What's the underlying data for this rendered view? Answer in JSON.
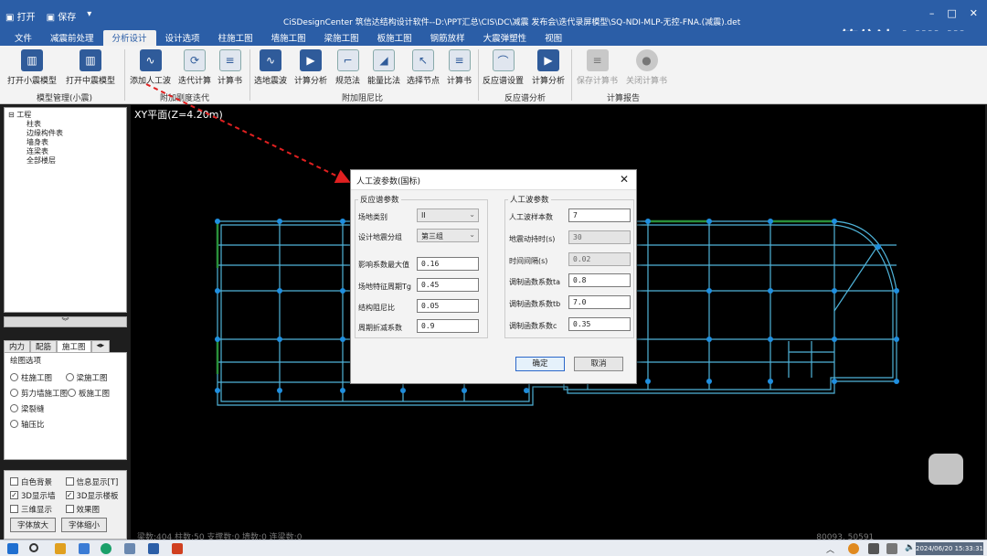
{
  "window": {
    "title": "CiSDesignCenter 筑信达结构设计软件--D:\\PPT汇总\\CIS\\DC\\减震 发布会\\迭代录屏模型\\SQ-NDI-MLP-无控-FNA.(减震).det",
    "quick_access": [
      "打开",
      "保存"
    ],
    "brand": "筑信达 bilibili"
  },
  "menu_tabs": [
    "文件",
    "减震前处理",
    "分析设计",
    "设计选项",
    "柱施工图",
    "墙施工图",
    "梁施工图",
    "板施工图",
    "钢筋放样",
    "大震弹塑性",
    "视图"
  ],
  "active_tab": "分析设计",
  "ribbon": {
    "buttons": [
      "打开小震模型",
      "打开中震模型",
      "添加人工波",
      "迭代计算",
      "计算书",
      "选地震波",
      "计算分析",
      "规范法",
      "能量比法",
      "选择节点",
      "计算书",
      "反应谱设置",
      "计算分析",
      "保存计算书",
      "关闭计算书"
    ],
    "groups": [
      "模型管理(小震)",
      "附加刚度迭代",
      "附加阻尼比",
      "反应谱分析",
      "计算报告"
    ]
  },
  "tree": {
    "root": "工程",
    "children": [
      "柱表",
      "边缘构件表",
      "墙身表",
      "连梁表",
      "全部楼层"
    ]
  },
  "panel_tabs": [
    "内力",
    "配筋",
    "施工图"
  ],
  "drawing_options": {
    "header": "绘图选项",
    "items": [
      "柱施工图",
      "梁施工图",
      "剪力墙施工图",
      "板施工图",
      "梁裂缝",
      "轴压比"
    ]
  },
  "display_checks": [
    {
      "label": "白色背景",
      "checked": false
    },
    {
      "label": "信息显示[T]",
      "checked": false
    },
    {
      "label": "3D显示墙",
      "checked": true
    },
    {
      "label": "3D显示楼板",
      "checked": true
    },
    {
      "label": "三维显示",
      "checked": false
    },
    {
      "label": "效果图",
      "checked": false
    }
  ],
  "font_buttons": [
    "字体放大",
    "字体缩小"
  ],
  "canvas": {
    "plane": "XY平面(Z=4.20m)",
    "status": "梁数:404 柱数:50 支撑数:0 墙数:0 连梁数:0",
    "coords": "80093, 50591"
  },
  "dialog": {
    "title": "人工波参数(国标)",
    "left_group": "反应谱参数",
    "right_group": "人工波参数",
    "left_fields": [
      {
        "label": "场地类别",
        "value": "II",
        "type": "select"
      },
      {
        "label": "设计地震分组",
        "value": "第三组",
        "type": "select"
      },
      {
        "label": "影响系数最大值",
        "value": "0.16",
        "type": "input"
      },
      {
        "label": "场地特征周期Tg",
        "value": "0.45",
        "type": "input"
      },
      {
        "label": "结构阻尼比",
        "value": "0.05",
        "type": "input"
      },
      {
        "label": "周期折减系数",
        "value": "0.9",
        "type": "input"
      }
    ],
    "right_fields": [
      {
        "label": "人工波样本数",
        "value": "7",
        "readonly": false
      },
      {
        "label": "地震动持时(s)",
        "value": "30",
        "readonly": true
      },
      {
        "label": "时间间隔(s)",
        "value": "0.02",
        "readonly": true
      },
      {
        "label": "调制函数系数ta",
        "value": "0.8",
        "readonly": false
      },
      {
        "label": "调制函数系数tb",
        "value": "7.0",
        "readonly": false
      },
      {
        "label": "调制函数系数c",
        "value": "0.35",
        "readonly": false
      }
    ],
    "ok": "确定",
    "cancel": "取消"
  },
  "taskbar": {
    "clock": "2024/06/20 15:33:31"
  },
  "colors": {
    "titlebar": "#2b5ea7",
    "grid_line": "#4fb3d9",
    "node": "#1f8fe0",
    "wall": "#2a8f3a",
    "annotation_arrow": "#e02020"
  }
}
